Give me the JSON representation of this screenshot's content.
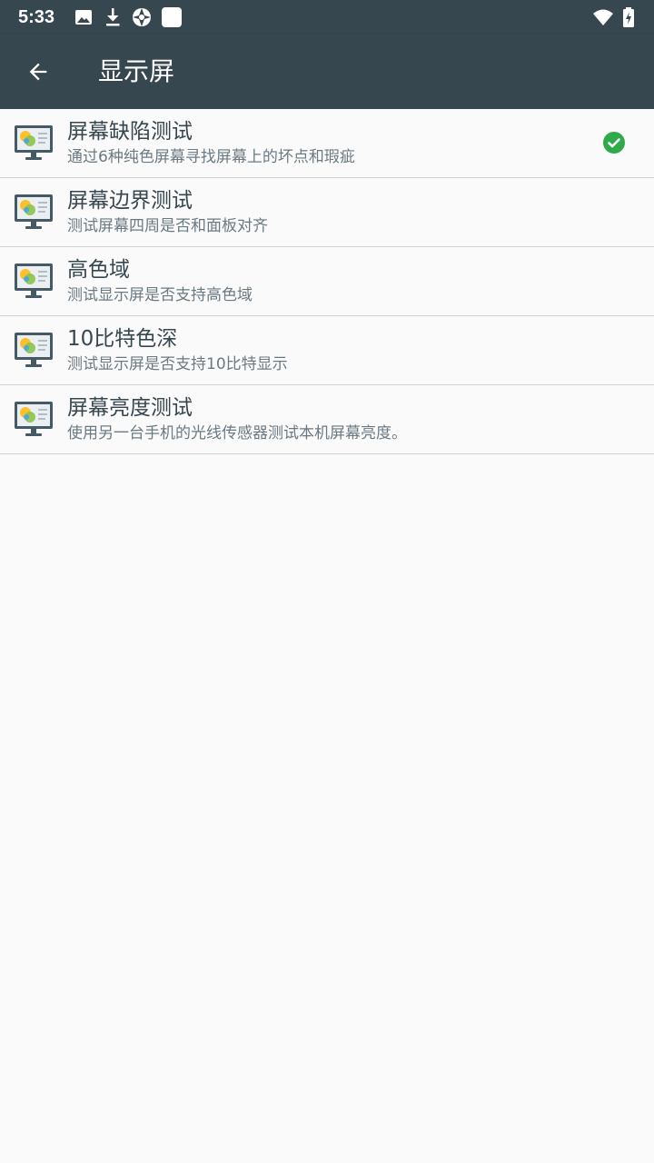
{
  "status_bar": {
    "time": "5:33",
    "left_icons": [
      "image-icon",
      "download-icon",
      "shutter-icon",
      "app-square-icon"
    ],
    "right_icons": [
      "wifi-icon",
      "battery-charging-icon"
    ]
  },
  "app_bar": {
    "title": "显示屏",
    "back_icon": "arrow-back-icon",
    "background": "#37474f"
  },
  "items": [
    {
      "title": "屏幕缺陷测试",
      "subtitle": "通过6种纯色屏幕寻找屏幕上的坏点和瑕疵",
      "icon": "monitor-icon",
      "completed": true
    },
    {
      "title": "屏幕边界测试",
      "subtitle": "测试屏幕四周是否和面板对齐",
      "icon": "monitor-icon",
      "completed": false
    },
    {
      "title": "高色域",
      "subtitle": "测试显示屏是否支持高色域",
      "icon": "monitor-icon",
      "completed": false
    },
    {
      "title": "10比特色深",
      "subtitle": "测试显示屏是否支持10比特显示",
      "icon": "monitor-icon",
      "completed": false
    },
    {
      "title": "屏幕亮度测试",
      "subtitle": "使用另一台手机的光线传感器测试本机屏幕亮度。",
      "icon": "monitor-icon",
      "completed": false
    }
  ],
  "colors": {
    "check": "#2eaa4a",
    "title_text": "#37474f",
    "subtitle_text": "#6b7a82"
  }
}
